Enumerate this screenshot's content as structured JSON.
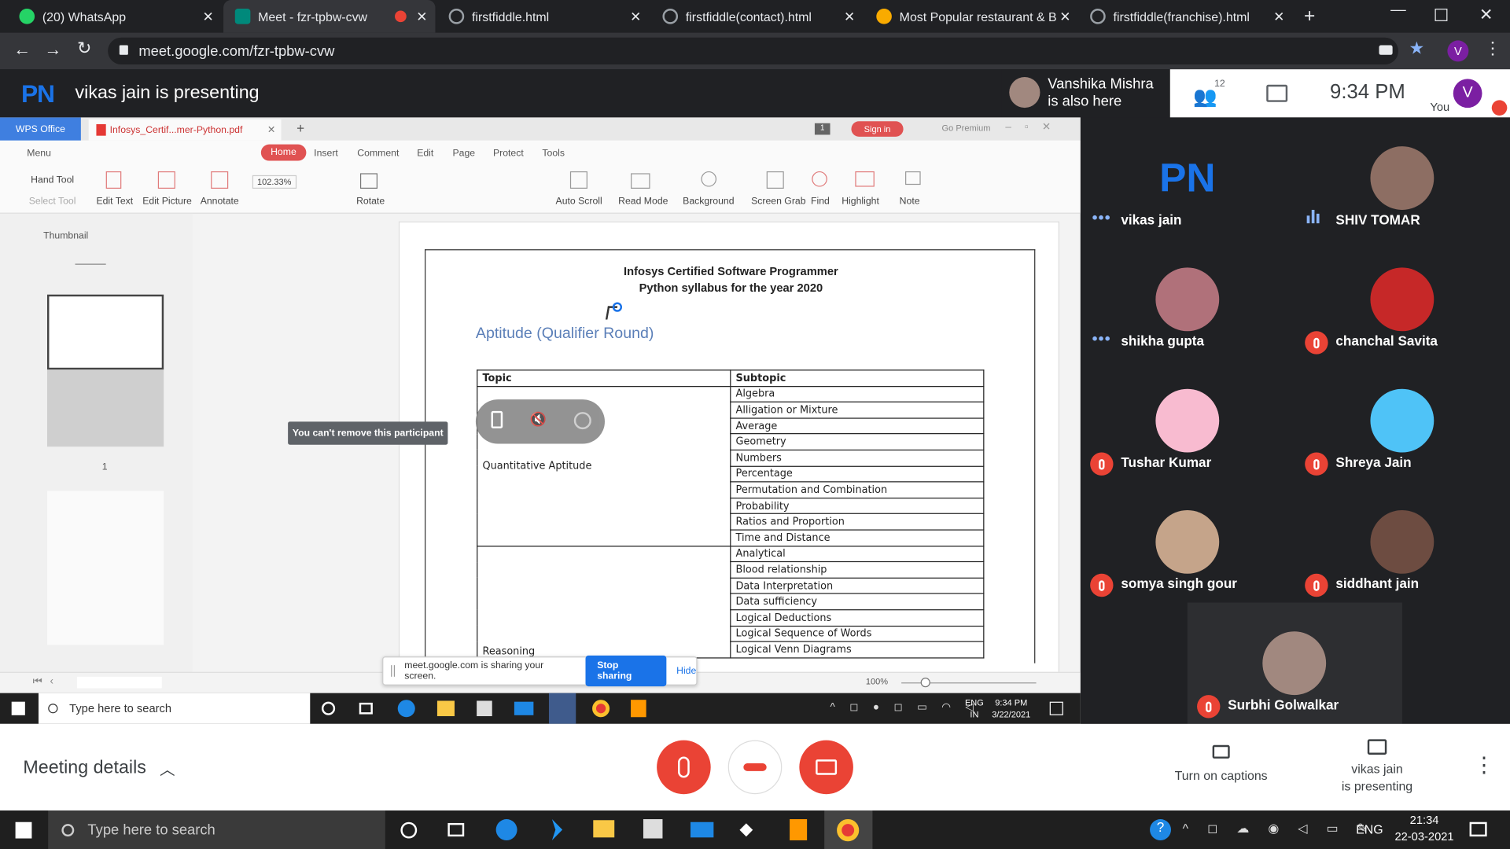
{
  "tabs": [
    {
      "title": "(20) WhatsApp",
      "color": "#25d366"
    },
    {
      "title": "Meet - fzr-tpbw-cvw",
      "color": "#00897b"
    },
    {
      "title": "firstfiddle.html",
      "color": "#9aa0a6"
    },
    {
      "title": "firstfiddle(contact).html",
      "color": "#9aa0a6"
    },
    {
      "title": "Most Popular restaurant & B",
      "color": "#f9ab00"
    },
    {
      "title": "firstfiddle(franchise).html",
      "color": "#9aa0a6"
    }
  ],
  "address": {
    "url": "meet.google.com/fzr-tpbw-cvw",
    "profile_initial": "V"
  },
  "meet": {
    "logo": "PN",
    "presenting_title": "vikas jain is presenting",
    "also_here_name": "Vanshika Mishra",
    "also_here_suffix": "is also here",
    "people_count": "12",
    "time": "9:34 PM",
    "you_label": "You",
    "you_initial": "V"
  },
  "wps": {
    "app_tab": "WPS Office",
    "doc_tab": "Infosys_Certif...mer-Python.pdf",
    "sign_in": "Sign in",
    "go_premium": "Go Premium",
    "page_badge": "1",
    "menu": [
      "Menu",
      "Home",
      "Insert",
      "Comment",
      "Edit",
      "Page",
      "Protect",
      "Tools"
    ],
    "tools": [
      "Hand Tool",
      "Select Tool",
      "Edit Text",
      "Edit Picture",
      "Annotate",
      "102.33%",
      "Rotate",
      "Auto Scroll",
      "Read Mode",
      "Background",
      "Screen Grab",
      "Find",
      "Highlight",
      "Note"
    ],
    "thumbnail_label": "Thumbnail",
    "page_number": "1",
    "zoom_status": "100%"
  },
  "document": {
    "title_line1": "Infosys Certified Software Programmer",
    "title_line2": "Python syllabus for the year 2020",
    "section": "Aptitude (Qualifier Round)",
    "col_topic": "Topic",
    "col_subtopic": "Subtopic",
    "groups": [
      {
        "topic": "Quantitative Aptitude",
        "subtopics": [
          "Algebra",
          "Alligation or Mixture",
          "Average",
          "Geometry",
          "Numbers",
          "Percentage",
          "Permutation and Combination",
          "Probability",
          "Ratios and Proportion",
          "Time and Distance"
        ]
      },
      {
        "topic": "Reasoning",
        "subtopics": [
          "Analytical",
          "Blood relationship",
          "Data Interpretation",
          "Data sufficiency",
          "Logical Deductions",
          "Logical Sequence of Words",
          "Logical Venn Diagrams"
        ]
      }
    ]
  },
  "overlay": {
    "tooltip": "You can't remove this participant",
    "sharing_text": "meet.google.com is sharing your screen.",
    "stop_sharing": "Stop sharing",
    "hide": "Hide"
  },
  "inner_taskbar": {
    "search": "Type here to search",
    "lang1": "ENG",
    "lang2": "IN",
    "time": "9:34 PM",
    "date": "3/22/2021"
  },
  "participants": [
    {
      "name": "vikas jain",
      "status": "dots",
      "avatar": "PN",
      "color": "#1a73e8"
    },
    {
      "name": "SHIV TOMAR",
      "status": "speaking",
      "avatar": "",
      "color": "#8d6e63"
    },
    {
      "name": "shikha gupta",
      "status": "dots",
      "avatar": "",
      "color": "#b0717a"
    },
    {
      "name": "chanchal Savita",
      "status": "muted",
      "avatar": "",
      "color": "#c62828"
    },
    {
      "name": "Tushar Kumar",
      "status": "muted",
      "avatar": "",
      "color": "#f8bbd0"
    },
    {
      "name": "Shreya Jain",
      "status": "muted",
      "avatar": "",
      "color": "#4fc3f7"
    },
    {
      "name": "somya singh gour",
      "status": "muted",
      "avatar": "",
      "color": "#c5a48a"
    },
    {
      "name": "siddhant jain",
      "status": "muted",
      "avatar": "",
      "color": "#6d4c41"
    },
    {
      "name": "Surbhi Golwalkar",
      "status": "muted",
      "avatar": "",
      "color": "#a1887f"
    }
  ],
  "bottom": {
    "meeting_details": "Meeting details",
    "captions": "Turn on captions",
    "presenting_line1": "vikas jain",
    "presenting_line2": "is presenting"
  },
  "taskbar": {
    "search": "Type here to search",
    "lang": "ENG",
    "time": "21:34",
    "date": "22-03-2021"
  }
}
